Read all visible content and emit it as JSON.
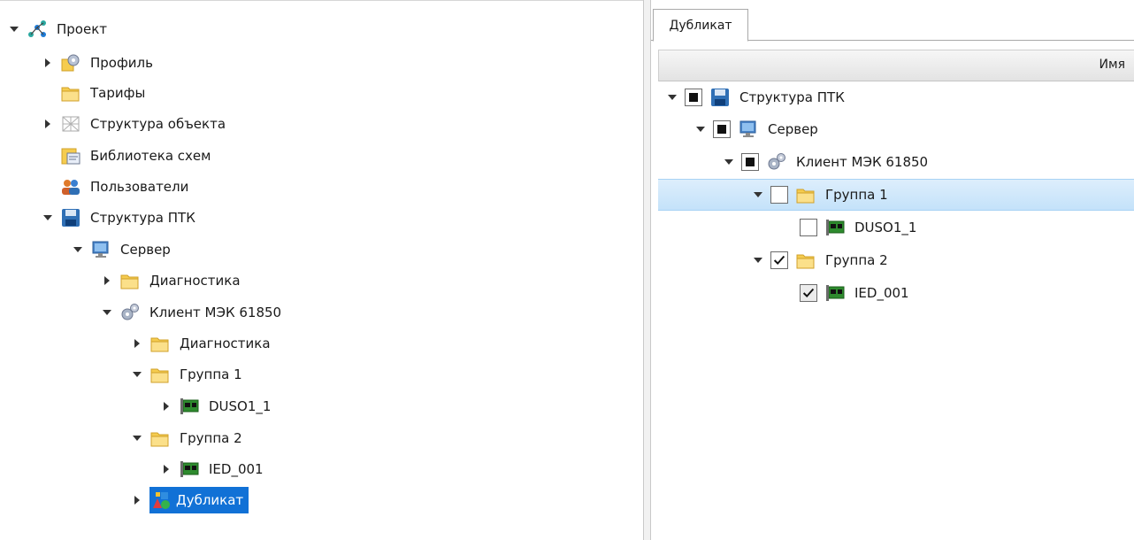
{
  "left_tree": {
    "project": "Проект",
    "profile": "Профиль",
    "tariffs": "Тарифы",
    "object_structure": "Структура объекта",
    "scheme_library": "Библиотека схем",
    "users": "Пользователи",
    "ptk_structure": "Структура ПТК",
    "server": "Сервер",
    "diagnostics_server": "Диагностика",
    "iec_client": "Клиент МЭК 61850",
    "diagnostics_client": "Диагностика",
    "group1": "Группа 1",
    "duso": "DUSO1_1",
    "group2": "Группа 2",
    "ied": "IED_001",
    "duplicate": "Дубликат"
  },
  "right_panel": {
    "tab": "Дубликат",
    "column_header": "Имя",
    "tree": {
      "ptk_structure": "Структура ПТК",
      "server": "Сервер",
      "iec_client": "Клиент МЭК 61850",
      "group1": "Группа 1",
      "duso": "DUSO1_1",
      "group2": "Группа 2",
      "ied": "IED_001"
    },
    "check_states": {
      "ptk_structure": "partial",
      "server": "partial",
      "iec_client": "partial",
      "group1": "unchecked",
      "duso": "unchecked",
      "group2": "checked",
      "ied": "checked-gray"
    }
  },
  "colors": {
    "selection": "#1171d6",
    "highlight_row": "#c4e2fa",
    "folder": "#f5cc4f",
    "board": "#2e8b2e"
  }
}
